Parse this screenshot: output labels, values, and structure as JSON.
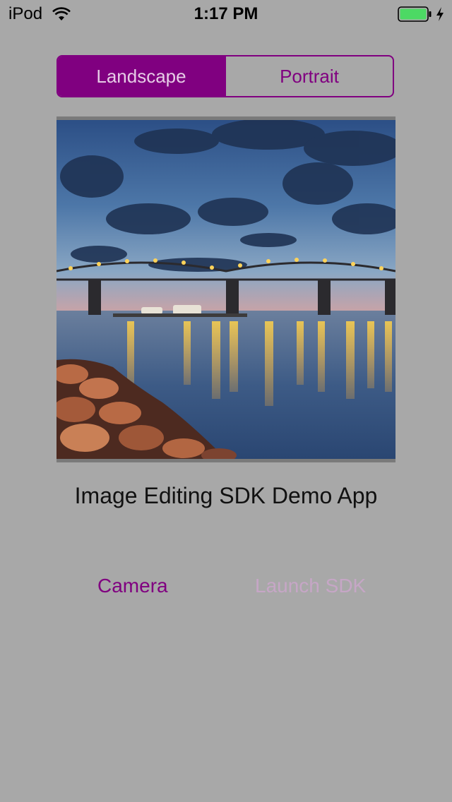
{
  "status_bar": {
    "carrier": "iPod",
    "time": "1:17 PM",
    "wifi_icon": "wifi-icon",
    "battery_icon": "battery-full-icon",
    "charging_icon": "charging-bolt-icon"
  },
  "segmented_control": {
    "options": [
      "Landscape",
      "Portrait"
    ],
    "selected": "Landscape"
  },
  "image": {
    "subject": "bridge-at-dusk-photo"
  },
  "main": {
    "title": "Image Editing SDK Demo App"
  },
  "actions": {
    "camera_label": "Camera",
    "launch_label": "Launch SDK",
    "launch_enabled": false
  },
  "colors": {
    "accent": "#800080",
    "background": "#a8a8a8",
    "disabled_text": "#c6a6c6",
    "battery_green": "#4cd964"
  }
}
